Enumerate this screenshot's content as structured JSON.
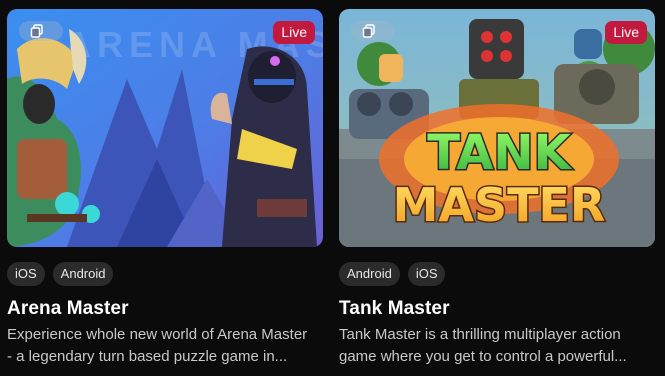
{
  "cards": [
    {
      "id": "arena-master",
      "title": "Arena Master",
      "badge": "Live",
      "tags": [
        "iOS",
        "Android"
      ],
      "description_lines": [
        "Experience whole new world of Arena Master",
        "- a legendary turn based puzzle game in..."
      ],
      "thumbnail_watermark": "ARENA MASTER"
    },
    {
      "id": "tank-master",
      "title": "Tank Master",
      "badge": "Live",
      "tags": [
        "Android",
        "iOS"
      ],
      "description_lines": [
        "Tank Master is a thrilling multiplayer action",
        "game where you get to control a powerful..."
      ],
      "thumbnail_logo": [
        "TANK",
        "MASTER"
      ]
    }
  ],
  "icons": {
    "copy": "copy-icon"
  },
  "colors": {
    "live_badge": "#c21a3e",
    "tag_bg": "#2b2b2b",
    "page_bg": "#0b0b0b"
  }
}
